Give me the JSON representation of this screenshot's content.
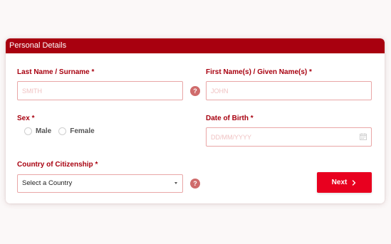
{
  "card": {
    "title": "Personal Details"
  },
  "fields": {
    "last_name": {
      "label": "Last Name / Surname *",
      "placeholder": "SMITH"
    },
    "first_name": {
      "label": "First Name(s) / Given Name(s) *",
      "placeholder": "JOHN"
    },
    "sex": {
      "label": "Sex *",
      "options": [
        "Male",
        "Female"
      ]
    },
    "dob": {
      "label": "Date of Birth *",
      "placeholder": "DD/MM/YYYY"
    },
    "citizenship": {
      "label": "Country of Citizenship *",
      "selected": "Select a Country"
    }
  },
  "help_glyph": "?",
  "next_button": {
    "label": "Next"
  },
  "icons": {
    "help": "question-circle-icon",
    "calendar": "calendar-icon",
    "dropdown": "caret-down-icon",
    "next": "chevron-right-icon"
  },
  "colors": {
    "header_bg": "#a8000f",
    "label": "#a8000f",
    "input_border": "#e9a6a6",
    "help_bg": "#cf6b6b",
    "button_bg": "#e8001f"
  }
}
